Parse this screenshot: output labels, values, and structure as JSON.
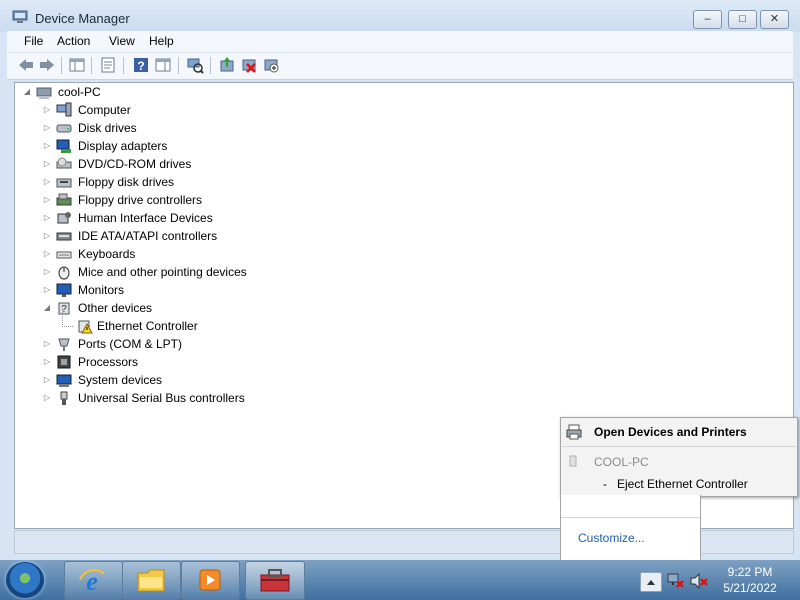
{
  "window": {
    "title": "Device Manager",
    "controls": {
      "minimize": "–",
      "maximize": "□",
      "close": "✕"
    }
  },
  "menu": [
    "File",
    "Action",
    "View",
    "Help"
  ],
  "toolbar_icons": [
    "back-arrow-icon",
    "forward-arrow-icon",
    "show-hide-console-tree-icon",
    "properties-icon",
    "help-icon",
    "action-pane-icon",
    "scan-hardware-changes-icon",
    "update-driver-icon",
    "uninstall-device-icon",
    "disable-device-icon"
  ],
  "tree": {
    "root": "cool-PC",
    "categories": [
      {
        "label": "Computer",
        "icon": "computer-icon",
        "expanded": false
      },
      {
        "label": "Disk drives",
        "icon": "disk-drive-icon",
        "expanded": false
      },
      {
        "label": "Display adapters",
        "icon": "display-adapter-icon",
        "expanded": false
      },
      {
        "label": "DVD/CD-ROM drives",
        "icon": "dvd-drive-icon",
        "expanded": false
      },
      {
        "label": "Floppy disk drives",
        "icon": "floppy-disk-icon",
        "expanded": false
      },
      {
        "label": "Floppy drive controllers",
        "icon": "floppy-controller-icon",
        "expanded": false
      },
      {
        "label": "Human Interface Devices",
        "icon": "hid-icon",
        "expanded": false
      },
      {
        "label": "IDE ATA/ATAPI controllers",
        "icon": "ide-controller-icon",
        "expanded": false
      },
      {
        "label": "Keyboards",
        "icon": "keyboard-icon",
        "expanded": false
      },
      {
        "label": "Mice and other pointing devices",
        "icon": "mouse-icon",
        "expanded": false
      },
      {
        "label": "Monitors",
        "icon": "monitor-icon",
        "expanded": false
      },
      {
        "label": "Other devices",
        "icon": "other-devices-icon",
        "expanded": true,
        "children": [
          {
            "label": "Ethernet Controller",
            "icon": "warning-device-icon"
          }
        ]
      },
      {
        "label": "Ports (COM & LPT)",
        "icon": "port-icon",
        "expanded": false
      },
      {
        "label": "Processors",
        "icon": "processor-icon",
        "expanded": false
      },
      {
        "label": "System devices",
        "icon": "system-device-icon",
        "expanded": false
      },
      {
        "label": "Universal Serial Bus controllers",
        "icon": "usb-icon",
        "expanded": false
      }
    ]
  },
  "popup": {
    "open_devices": "Open Devices and Printers",
    "device_name": "COOL-PC",
    "eject_prefix": "-",
    "eject_label": "Eject Ethernet Controller",
    "customize": "Customize..."
  },
  "taskbar": {
    "buttons": [
      "internet-explorer-icon",
      "windows-explorer-icon",
      "media-player-icon",
      "device-manager-toolbox-icon"
    ],
    "tray": {
      "time": "9:22 PM",
      "date": "5/21/2022"
    }
  },
  "colors": {
    "window_frame": "#d6e4f3",
    "taskbar": "#4f7fae",
    "link": "#1f5ea8"
  }
}
